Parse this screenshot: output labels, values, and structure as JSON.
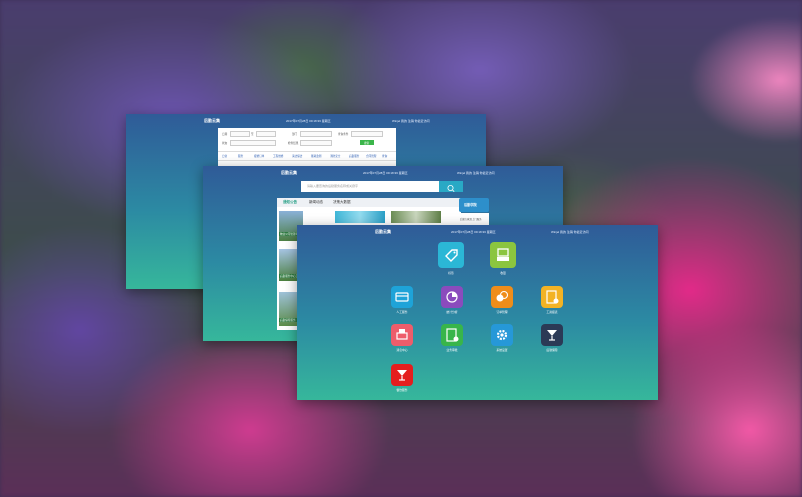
{
  "back_window": {
    "title": "后勤云集",
    "time": "2017年07月28日 09:18:36 星期五",
    "links": "Winjel  我的  注销  你最近访问",
    "form_labels": [
      "日期",
      "至",
      "部门",
      "查询条件",
      "状态",
      "收费",
      "类别",
      "检查结果",
      "搜索"
    ],
    "tabs": [
      "日常",
      "服务",
      "报修订单",
      "工程维修",
      "清洁保洁",
      "能耗监测",
      "消防安全",
      "后勤服务",
      "合同管理",
      "查询"
    ]
  },
  "middle_window": {
    "title": "后勤云集",
    "time": "2017年07月28日 09:18:36 星期五",
    "links": "Winjel  我的  注销  你最近访问",
    "search_placeholder": "请输入要查询的后勤服务名称或关键字",
    "tabs": [
      "通知公告",
      "新闻动态",
      "决策大数据"
    ],
    "badge": "后勤学院",
    "side_label": "后勤大家居上门服务",
    "news_captions": [
      "物业公司管理考评结果",
      "后勤服务中心工作部署",
      "后勤保障服务"
    ]
  },
  "front_window": {
    "title": "后勤云集",
    "time": "2017年07月28日 09:18:36 星期五",
    "links": "Winjel  我的  注销  你最近访问",
    "apps": [
      {
        "label": "标签",
        "color": "#2bb7d6",
        "icon": "tag-icon"
      },
      {
        "label": "收银",
        "color": "#8bc53f",
        "icon": "register-icon"
      },
      {
        "label": "人工服务",
        "color": "#1ea3d8",
        "icon": "card-icon"
      },
      {
        "label": "统计分析",
        "color": "#8b4bbd",
        "icon": "pie-chart-icon"
      },
      {
        "label": "订单管理",
        "color": "#ef8d1a",
        "icon": "coins-icon"
      },
      {
        "label": "工资报表",
        "color": "#f3b324",
        "icon": "report-icon"
      },
      {
        "label": "消息中心",
        "color": "#ee5d6b",
        "icon": "print-icon"
      },
      {
        "label": "业务审批",
        "color": "#38b54a",
        "icon": "form-icon"
      },
      {
        "label": "系统设置",
        "color": "#2698d8",
        "icon": "gear-icon"
      },
      {
        "label": "后勤保障",
        "color": "#2b3a56",
        "icon": "cocktail-icon"
      },
      {
        "label": "餐饮服务",
        "color": "#e41e1e",
        "icon": "cocktail-red-icon"
      }
    ]
  }
}
